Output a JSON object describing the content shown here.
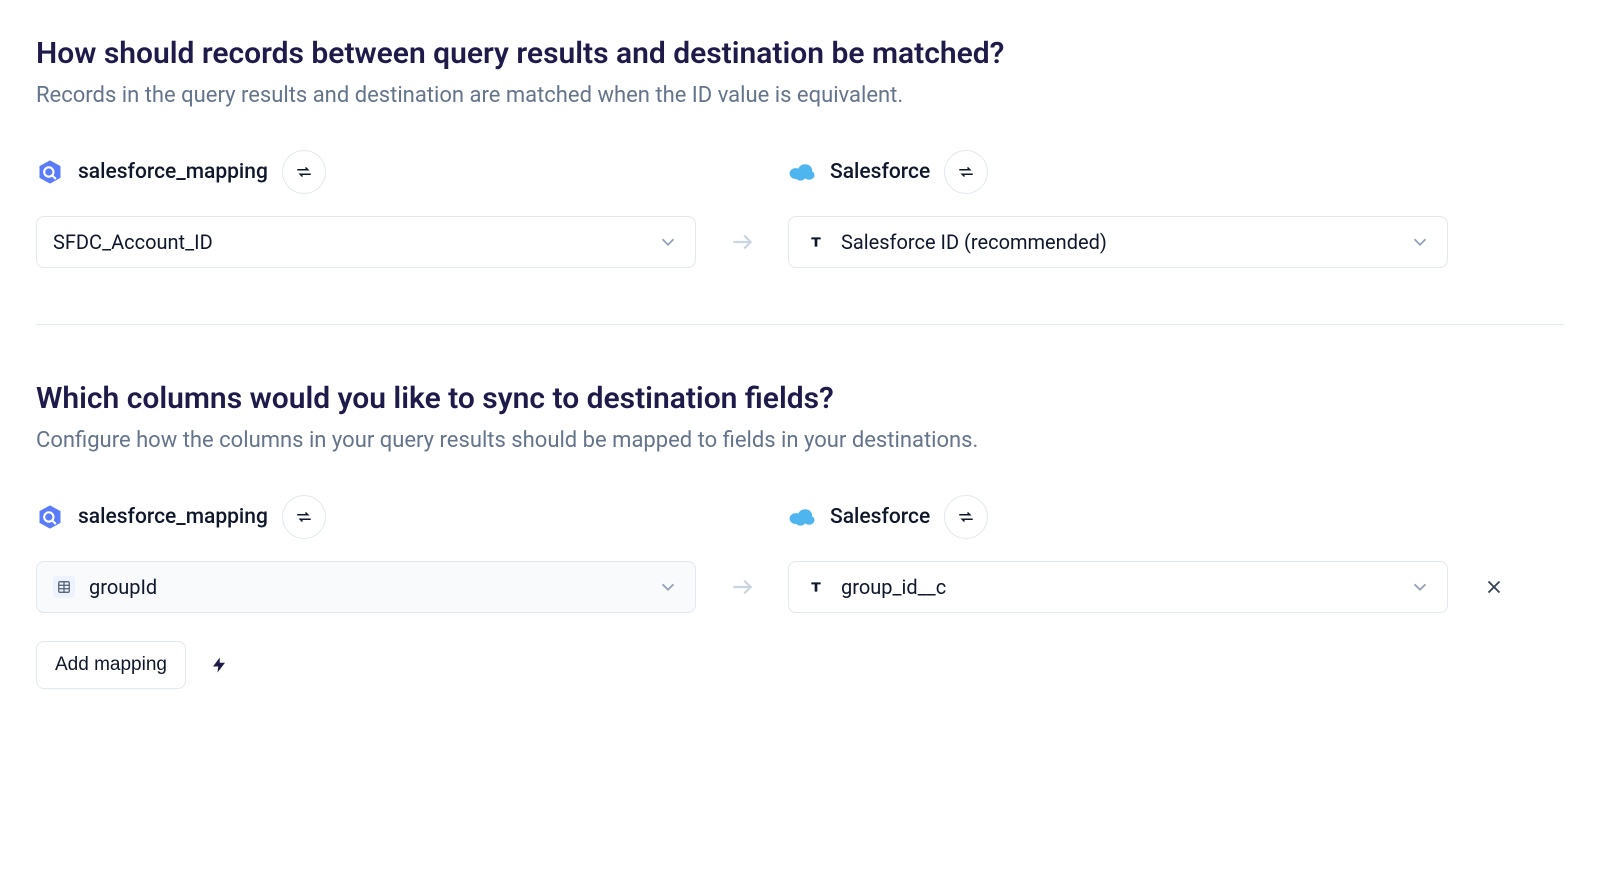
{
  "section1": {
    "title": "How should records between query results and destination be matched?",
    "subtitle": "Records in the query results and destination are matched when the ID value is equivalent.",
    "source_label": "salesforce_mapping",
    "dest_label": "Salesforce",
    "source_value": "SFDC_Account_ID",
    "dest_value": "Salesforce ID (recommended)"
  },
  "section2": {
    "title": "Which columns would you like to sync to destination fields?",
    "subtitle": "Configure how the columns in your query results should be mapped to fields in your destinations.",
    "source_label": "salesforce_mapping",
    "dest_label": "Salesforce",
    "source_value": "groupId",
    "dest_value": "group_id__c",
    "add_button": "Add mapping"
  }
}
